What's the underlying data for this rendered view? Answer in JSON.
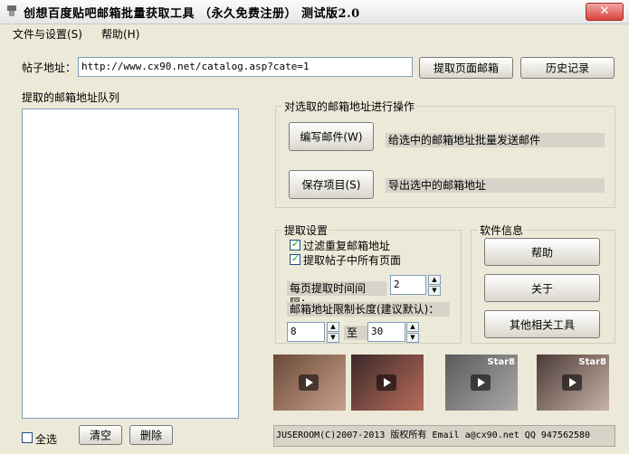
{
  "window": {
    "title": "创想百度贴吧邮箱批量获取工具 （永久免费注册）  测试版2.0",
    "close_label": "✕"
  },
  "menu": [
    "文件与设置(S)",
    "帮助(H)"
  ],
  "url_section": {
    "label": "帖子地址：",
    "value": "http://www.cx90.net/catalog.asp?cate=1",
    "extract_button": "提取页面邮箱",
    "history_button": "历史记录"
  },
  "queue": {
    "title": "提取的邮箱地址队列",
    "select_all_label": "全选",
    "clear_button": "清空",
    "delete_button": "删除"
  },
  "operations": {
    "title": "对选取的邮箱地址进行操作",
    "compose_button": "编写邮件(W)",
    "compose_desc": "给选中的邮箱地址批量发送邮件",
    "save_button": "保存项目(S)",
    "save_desc": "导出选中的邮箱地址"
  },
  "extract_settings": {
    "title": "提取设置",
    "filter_dup_label": "过滤重复邮箱地址",
    "filter_dup_checked": true,
    "all_pages_label": "提取帖子中所有页面",
    "all_pages_checked": true,
    "interval_label": "每页提取时间间隔：",
    "interval_value": "2",
    "length_label": "邮箱地址限制长度(建议默认)：",
    "length_min": "8",
    "length_to_label": "至",
    "length_max": "30"
  },
  "software_info": {
    "title": "软件信息",
    "help_button": "帮助",
    "about_button": "关于",
    "tools_button": "其他相关工具"
  },
  "thumbnails": [
    {
      "tag": "",
      "colors": [
        "#6b4a38",
        "#c7a08a"
      ]
    },
    {
      "tag": "",
      "colors": [
        "#3d2a2a",
        "#b86b5a"
      ]
    },
    {
      "tag": "Star8",
      "colors": [
        "#5a5a5a",
        "#a9a9a9"
      ]
    },
    {
      "tag": "Star8",
      "colors": [
        "#4a3a36",
        "#c9b3a8"
      ]
    }
  ],
  "status_bar": "JUSEROOM(C)2007-2013 版权所有 Email a@cx90.net QQ 947562580"
}
